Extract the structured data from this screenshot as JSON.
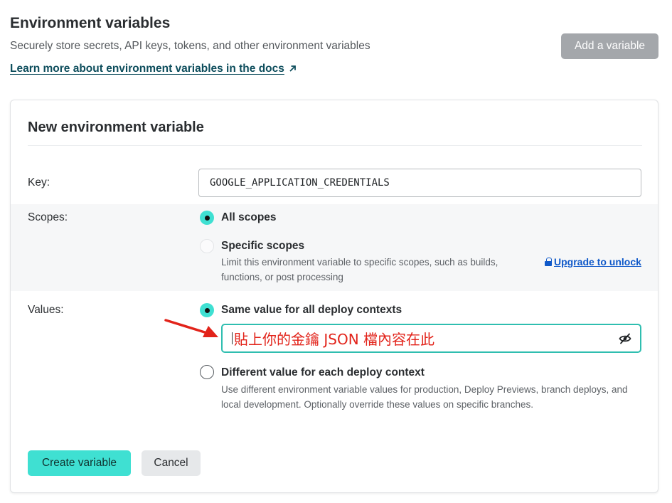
{
  "header": {
    "title": "Environment variables",
    "subtitle": "Securely store secrets, API keys, tokens, and other environment variables",
    "docs_link": "Learn more about environment variables in the docs",
    "docs_link_icon": "external-arrow-icon",
    "add_button": "Add a variable"
  },
  "form": {
    "title": "New environment variable",
    "key": {
      "label": "Key:",
      "value": "GOOGLE_APPLICATION_CREDENTIALS"
    },
    "scopes": {
      "label": "Scopes:",
      "options": [
        {
          "label": "All scopes",
          "selected": true,
          "disabled": false
        },
        {
          "label": "Specific scopes",
          "selected": false,
          "disabled": true,
          "description": "Limit this environment variable to specific scopes, such as builds, functions, or post processing"
        }
      ],
      "upgrade_link": "Upgrade to unlock",
      "upgrade_icon": "lock-icon"
    },
    "values": {
      "label": "Values:",
      "options": [
        {
          "label": "Same value for all deploy contexts",
          "selected": true
        },
        {
          "label": "Different value for each deploy context",
          "selected": false,
          "description": "Use different environment variable values for production, Deploy Previews, branch deploys, and local development. Optionally override these values on specific branches."
        }
      ],
      "value_placeholder": "貼上你的金鑰 JSON 檔內容在此",
      "visibility_icon": "eye-slash-icon"
    },
    "create_button": "Create variable",
    "cancel_button": "Cancel"
  },
  "colors": {
    "accent": "#3fe0d2",
    "input_focus": "#2fbeb0",
    "annotation": "#e2231a",
    "link": "#1059c9",
    "disabled_button": "#a4a7ab"
  }
}
